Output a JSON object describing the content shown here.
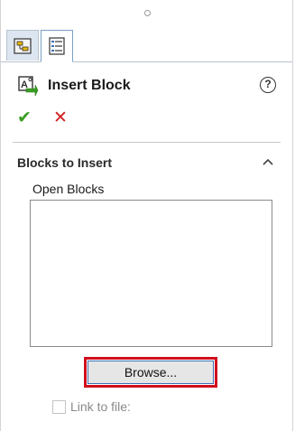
{
  "header": {
    "title": "Insert Block",
    "help_symbol": "?"
  },
  "tabs": [
    {
      "icon": "feature-manager-icon"
    },
    {
      "icon": "property-manager-icon"
    }
  ],
  "actions": {
    "ok_symbol": "✔",
    "cancel_symbol": "✕"
  },
  "section": {
    "title": "Blocks to Insert",
    "open_blocks_label": "Open Blocks",
    "browse_label": "Browse...",
    "link_to_file_label": "Link to file:",
    "link_to_file_checked": false
  },
  "colors": {
    "ok": "#3a9d23",
    "cancel": "#d21e1e",
    "highlight": "#d0101e"
  }
}
